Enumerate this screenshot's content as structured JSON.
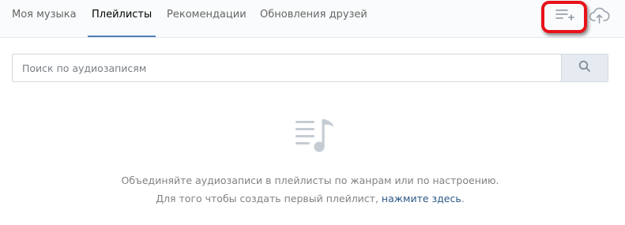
{
  "tabs": [
    {
      "label": "Моя музыка",
      "active": false
    },
    {
      "label": "Плейлисты",
      "active": true
    },
    {
      "label": "Рекомендации",
      "active": false
    },
    {
      "label": "Обновления друзей",
      "active": false
    }
  ],
  "actions": {
    "add_playlist_icon": "add-playlist-icon",
    "upload_icon": "cloud-upload-icon",
    "highlight_color": "#e8121a"
  },
  "search": {
    "placeholder": "Поиск по аудиозаписям",
    "value": "",
    "button_icon": "search-icon"
  },
  "empty_state": {
    "icon": "music-list-icon",
    "line1": "Объединяйте аудиозаписи в плейлисты по жанрам или по настроению.",
    "line2_prefix": "Для того чтобы создать первый плейлист, ",
    "line2_link": "нажмите здесь",
    "line2_suffix": "."
  },
  "colors": {
    "active_tab_underline": "#5181b8",
    "link": "#2a5885",
    "muted_text": "#828282",
    "icon_gray": "#99a2ad"
  }
}
